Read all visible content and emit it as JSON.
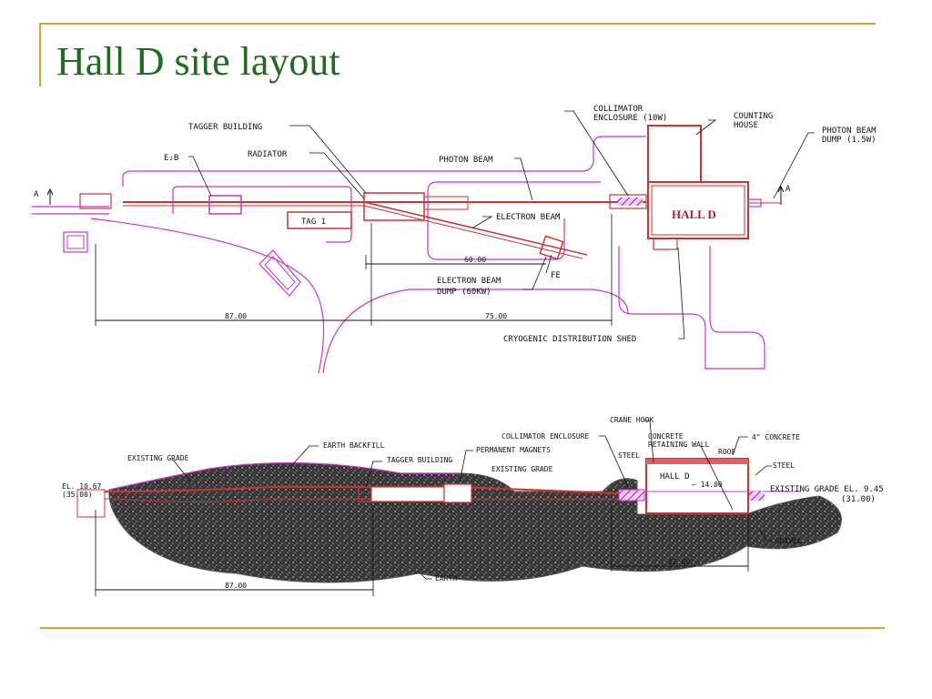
{
  "title": "Hall D site layout",
  "plan": {
    "tagger_building": "TAGGER BUILDING",
    "radiator": "RADIATOR",
    "e2b": "E₂B",
    "photon_beam": "PHOTON BEAM",
    "collimator": "COLLIMATOR",
    "collimator2": "ENCLOSURE (10W)",
    "counting": "COUNTING",
    "counting2": "HOUSE",
    "photon_dump": "PHOTON BEAM",
    "photon_dump2": "DUMP (1.5W)",
    "tag1": "TAG 1",
    "electron_beam": "ELECTRON BEAM",
    "hall_d": "HALL D",
    "dim_60": "60.00",
    "fe": "FE",
    "edump": "ELECTRON BEAM",
    "edump2": "DUMP (60KW)",
    "dim_87": "87.00",
    "dim_75": "75.00",
    "cryo": "CRYOGENIC DISTRIBUTION SHED",
    "a_left": "A",
    "a_right": "A"
  },
  "section": {
    "existing_grade": "EXISTING GRADE",
    "earth_backfill": "EARTH BACKFILL",
    "tagger_building": "TAGGER BUILDING",
    "permanent_magnets": "PERMANENT MAGNETS",
    "existing_grade2": "EXISTING   GRADE",
    "collimator": "COLLIMATOR ENCLOSURE",
    "crane": "CRANE HOOK",
    "concrete": "CONCRETE",
    "retaining": "RETAINING WALL",
    "concrete4": "4\" CONCRETE",
    "roof": "ROOF",
    "steel_left": "STEEL",
    "steel_right": "STEEL",
    "hall_d": "HALL D",
    "dim_14": "~ 14.00",
    "el_left": "EL. 10.67",
    "el_left2": "(35.00)",
    "el_right": "EXISTING GRADE EL. 9.45",
    "el_right2": "(31.00)",
    "gravel": "GRAVEL",
    "earth": "EARTH",
    "dim_42": "42.00",
    "dim_87": "87.00"
  }
}
